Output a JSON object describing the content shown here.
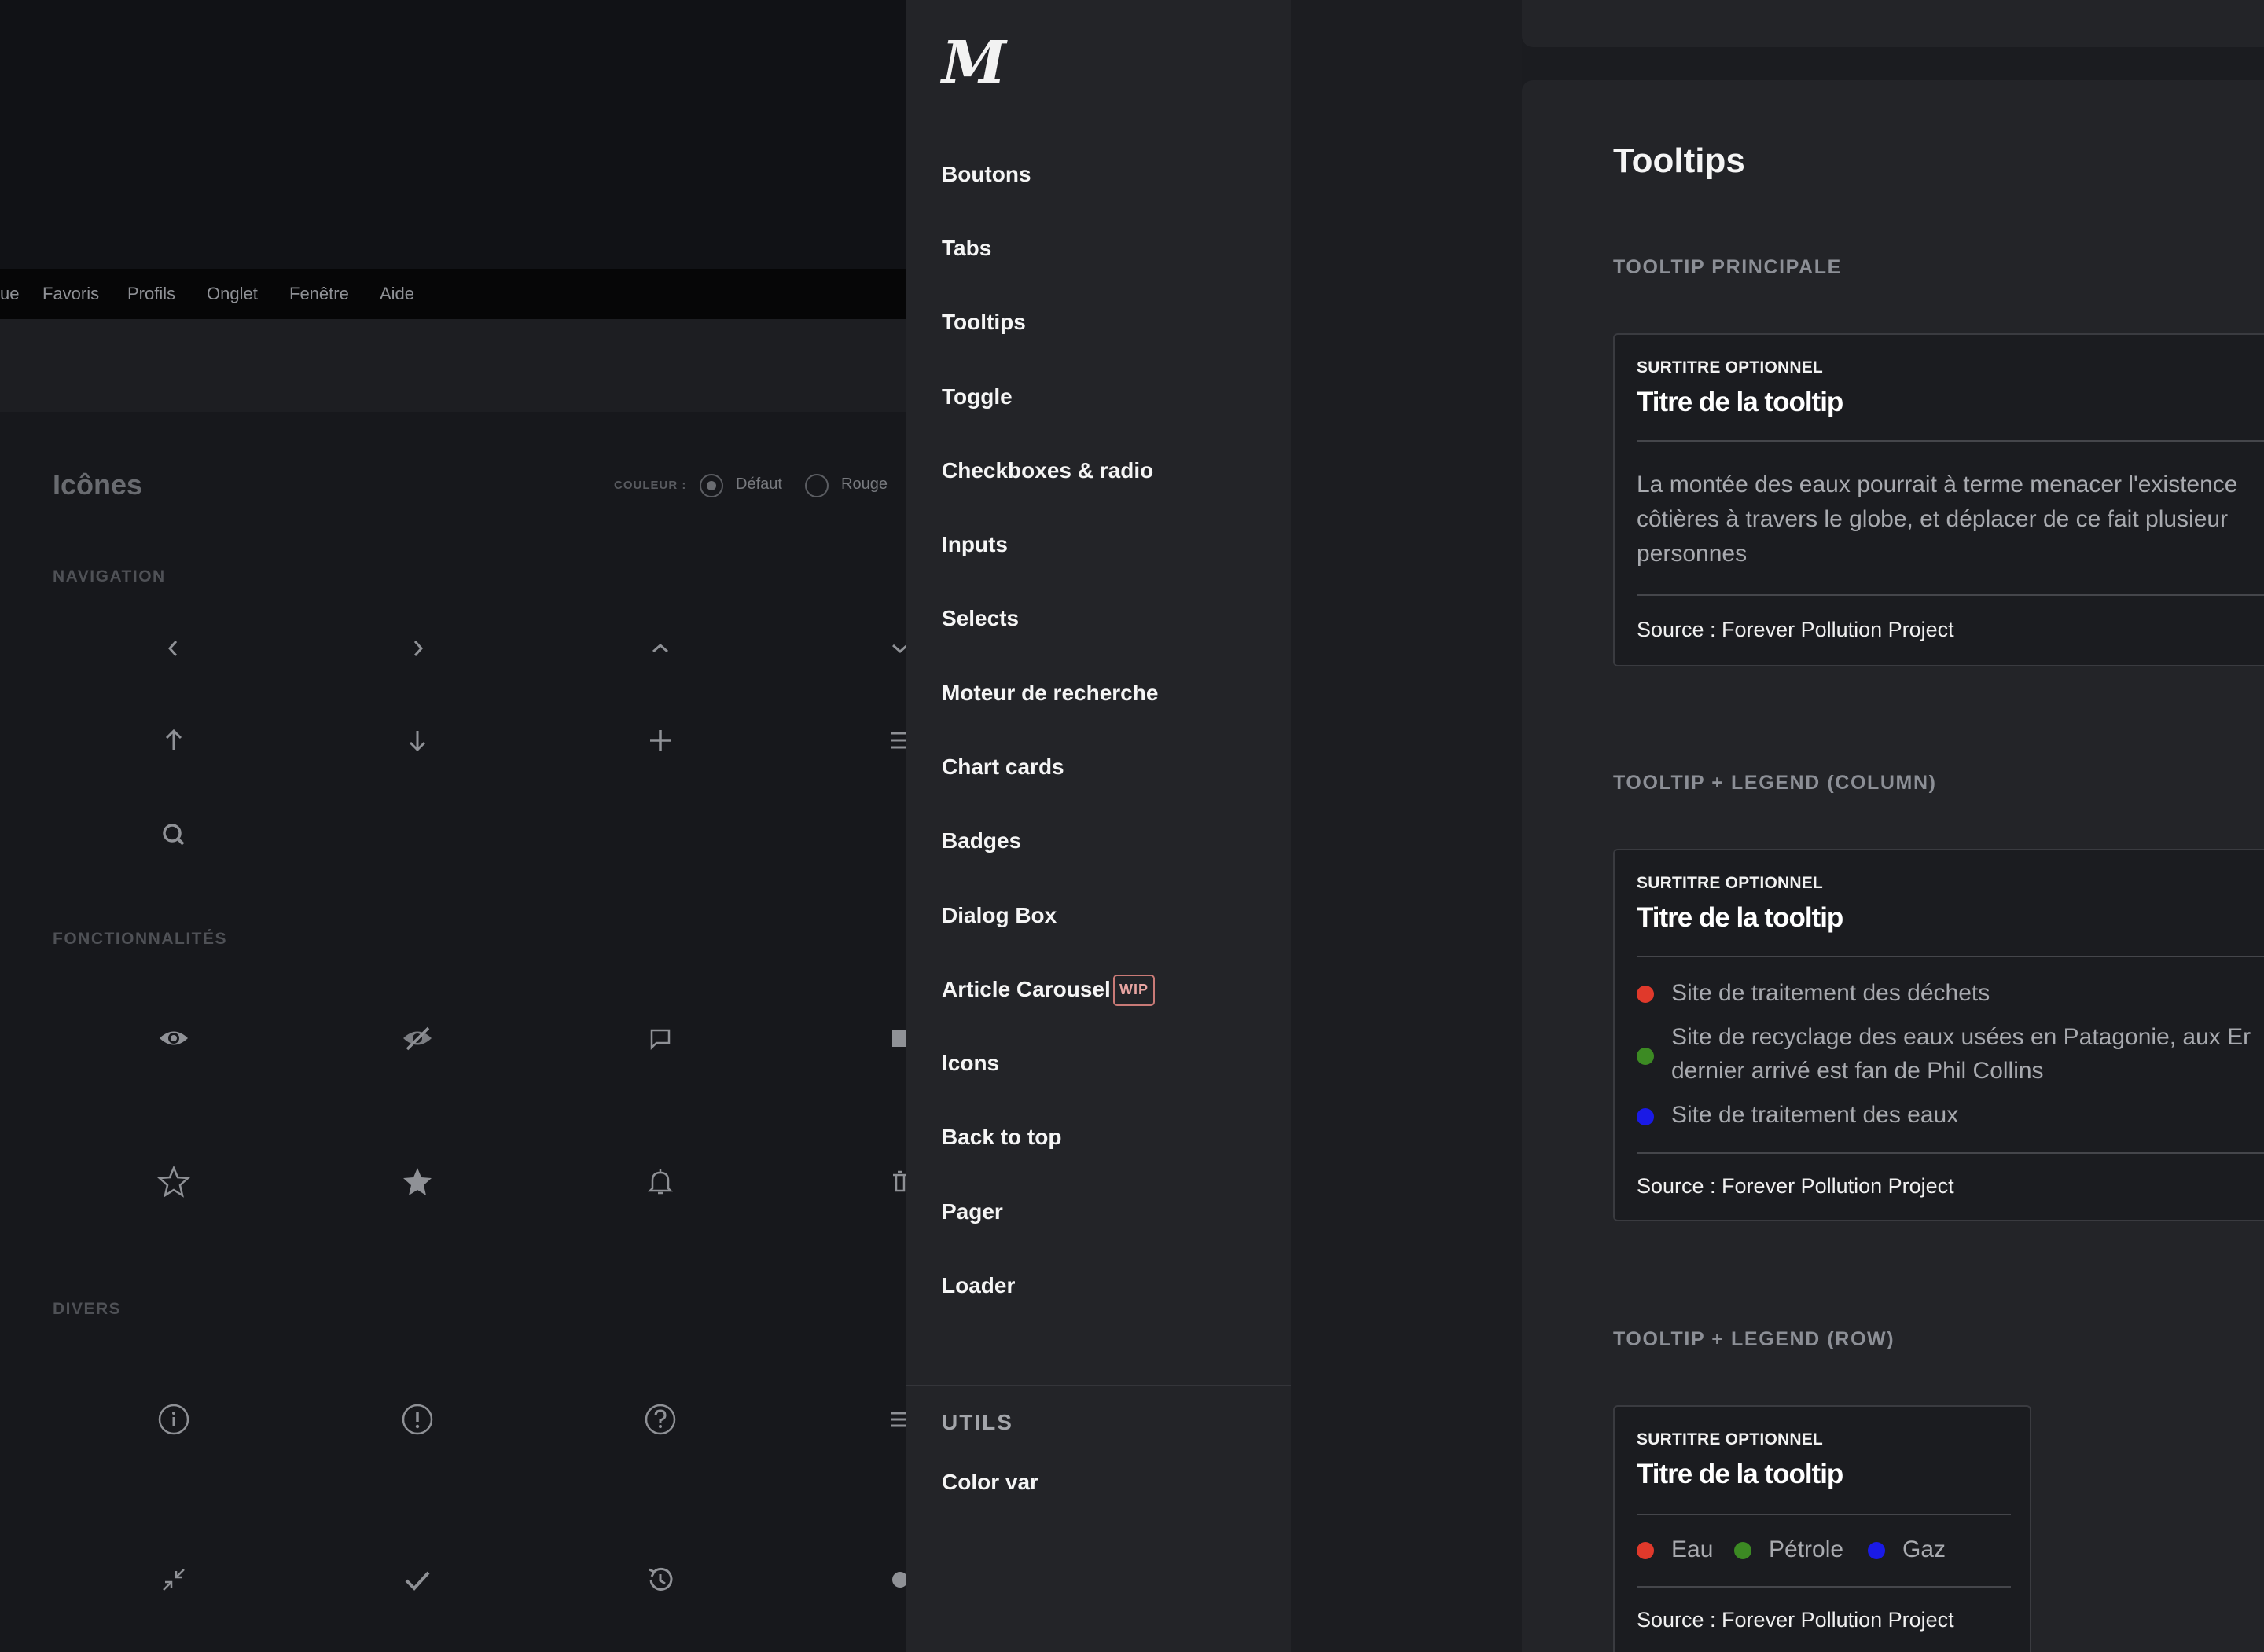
{
  "background_app": {
    "menubar": [
      "ue",
      "Favoris",
      "Profils",
      "Onglet",
      "Fenêtre",
      "Aide"
    ],
    "title": "Icônes",
    "couleur_label": "COULEUR :",
    "radio_default": "Défaut",
    "radio_red": "Rouge",
    "sections": {
      "navigation": "NAVIGATION",
      "fonctionnalites": "FONCTIONNALITÉS",
      "divers": "DIVERS"
    },
    "icons": [
      "chevron-left-icon",
      "chevron-right-icon",
      "chevron-up-icon",
      "chevron-down-icon",
      "arrow-up-icon",
      "arrow-down-icon",
      "plus-icon",
      "menu-icon",
      "search-icon",
      "eye-icon",
      "eye-off-icon",
      "comment-icon",
      "star-outline-icon",
      "star-filled-icon",
      "bell-icon",
      "info-icon",
      "alert-icon",
      "help-icon",
      "collapse-icon",
      "check-icon",
      "history-icon"
    ]
  },
  "sidebar": {
    "logo": "M",
    "items": [
      {
        "label": "Boutons"
      },
      {
        "label": "Tabs"
      },
      {
        "label": "Tooltips"
      },
      {
        "label": "Toggle"
      },
      {
        "label": "Checkboxes & radio"
      },
      {
        "label": "Inputs"
      },
      {
        "label": "Selects"
      },
      {
        "label": "Moteur de recherche"
      },
      {
        "label": "Chart cards"
      },
      {
        "label": "Badges"
      },
      {
        "label": "Dialog Box"
      },
      {
        "label": "Article Carousel",
        "badge": "WIP"
      },
      {
        "label": "Icons"
      },
      {
        "label": "Back to top"
      },
      {
        "label": "Pager"
      },
      {
        "label": "Loader"
      }
    ],
    "utils_title": "UTILS",
    "utils_items": [
      {
        "label": "Color var"
      }
    ]
  },
  "main": {
    "title": "Tooltips",
    "sections": [
      {
        "label": "TOOLTIP PRINCIPALE",
        "tooltip": {
          "overtitle": "SURTITRE OPTIONNEL",
          "title": "Titre de la tooltip",
          "body": [
            "La montée des eaux pourrait à terme menacer l'existence",
            "côtières à travers le globe, et déplacer de ce fait plusieur",
            "personnes"
          ],
          "source": "Source : Forever Pollution Project"
        }
      },
      {
        "label": "TOOLTIP + LEGEND (COLUMN)",
        "tooltip": {
          "overtitle": "SURTITRE OPTIONNEL",
          "title": "Titre de la tooltip",
          "legend": [
            {
              "lines": [
                "Site de traitement des déchets"
              ],
              "color": "#e0392b"
            },
            {
              "lines": [
                "Site de recyclage des eaux usées en Patagonie, aux Er",
                "dernier arrivé est fan de Phil Collins"
              ],
              "color": "#3c8a23"
            },
            {
              "lines": [
                "Site de traitement des eaux"
              ],
              "color": "#1a1ae6"
            }
          ],
          "source": "Source : Forever Pollution Project"
        }
      },
      {
        "label": "TOOLTIP + LEGEND (ROW)",
        "tooltip": {
          "overtitle": "SURTITRE OPTIONNEL",
          "title": "Titre de la tooltip",
          "legend": [
            {
              "label": "Eau",
              "color": "#e0392b"
            },
            {
              "label": "Pétrole",
              "color": "#3c8a23"
            },
            {
              "label": "Gaz",
              "color": "#1a1ae6"
            }
          ],
          "source": "Source : Forever Pollution Project"
        }
      }
    ]
  }
}
